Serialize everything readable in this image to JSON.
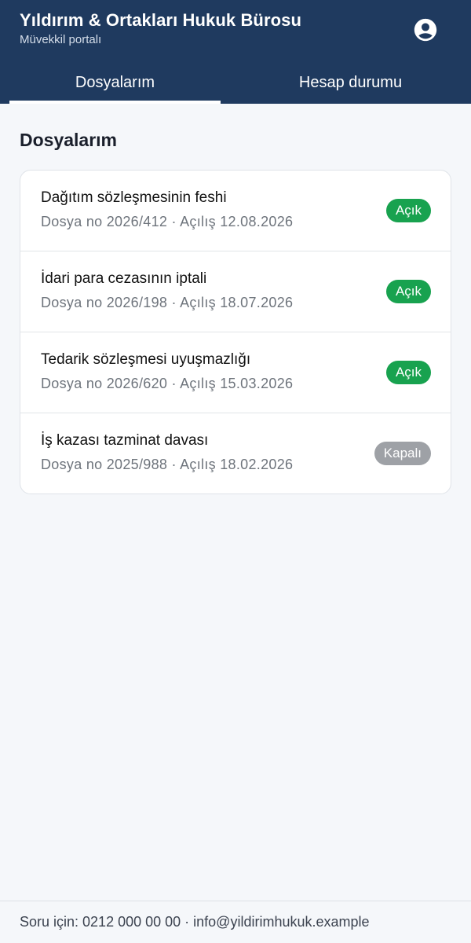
{
  "header": {
    "title": "Yıldırım & Ortakları Hukuk Bürosu",
    "subtitle": "Müvekkil portalı",
    "profile_icon": "account-circle-icon"
  },
  "tabs": [
    {
      "label": "Dosyalarım",
      "active": true
    },
    {
      "label": "Hesap durumu",
      "active": false
    }
  ],
  "main": {
    "section_title": "Dosyalarım",
    "cases": [
      {
        "title": "Dağıtım sözleşmesinin feshi",
        "meta": "Dosya no 2026/412 · Açılış 12.08.2026",
        "status": "Açık"
      },
      {
        "title": "İdari para cezasının iptali",
        "meta": "Dosya no 2026/198 · Açılış 18.07.2026",
        "status": "Açık"
      },
      {
        "title": "Tedarik sözleşmesi uyuşmazlığı",
        "meta": "Dosya no 2026/620 · Açılış 15.03.2026",
        "status": "Açık"
      },
      {
        "title": "İş kazası tazminat davası",
        "meta": "Dosya no 2025/988 · Açılış 18.02.2026",
        "status": "Kapalı"
      }
    ]
  },
  "footer": {
    "text": "Soru için: 0212 000 00 00 · info@yildirimhukuk.example"
  },
  "colors": {
    "header_bg": "#1f3a5f",
    "open_badge": "#18a24f",
    "closed_badge": "#9ea1a6",
    "page_bg": "#f5f7fa"
  }
}
